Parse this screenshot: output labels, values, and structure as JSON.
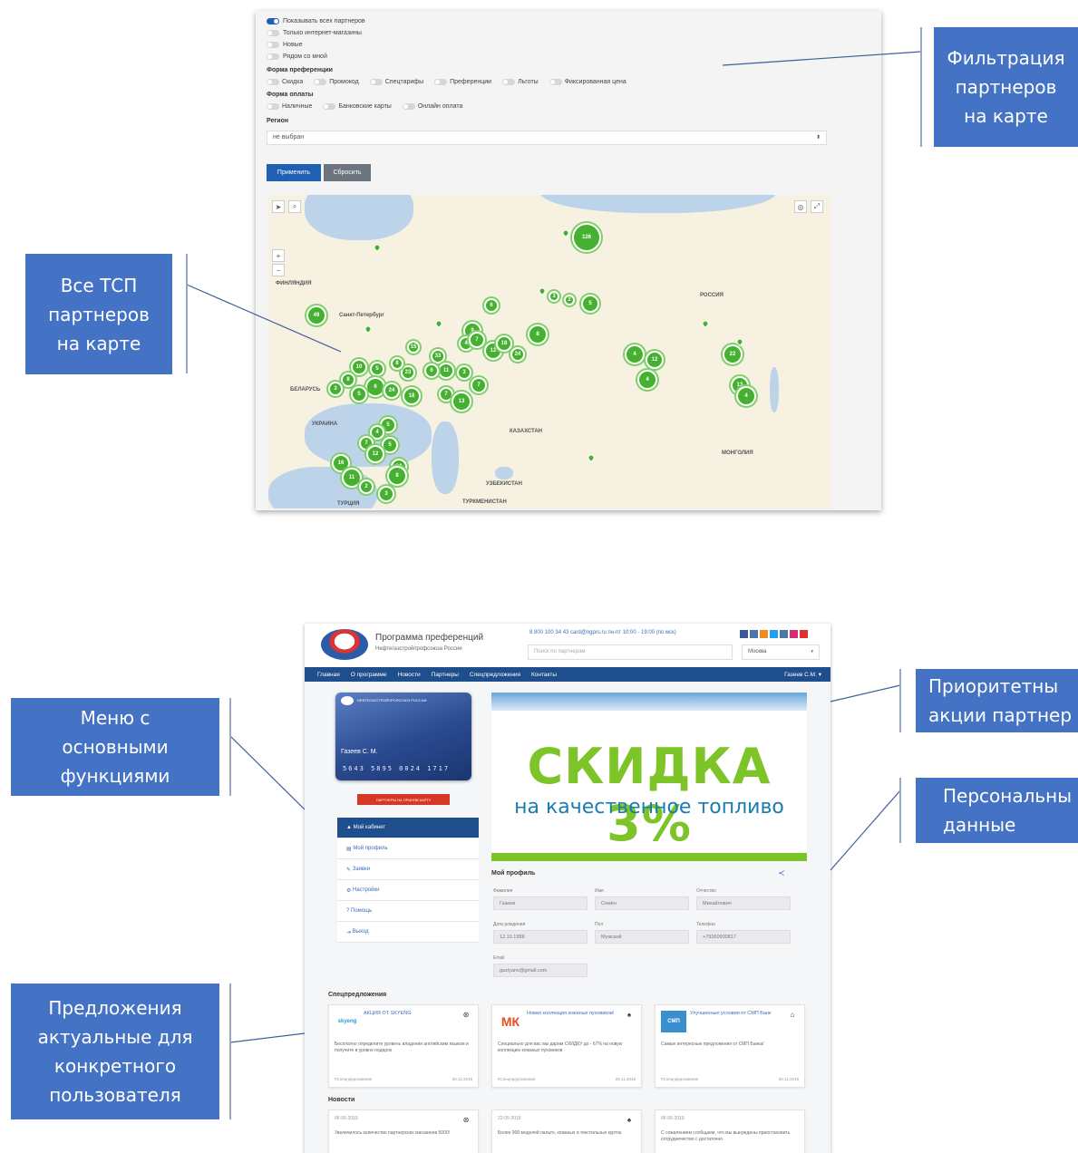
{
  "callouts": {
    "filter": "Фильтрация\nпартнеров\nна карте",
    "all_tsp": "Все ТСП\nпартнеров\nна карте",
    "menu": "Меню с\nосновными\nфункциями",
    "offers": "Предложения\nактуальные для\nконкретного\nпользователя",
    "priority": "Приоритетны\nакции партнер",
    "personal": "Персональны\nданные"
  },
  "filters": {
    "toggles": [
      {
        "label": "Показывать всех партнеров",
        "on": true
      },
      {
        "label": "Только интернет-магазины",
        "on": false
      },
      {
        "label": "Новые",
        "on": false
      },
      {
        "label": "Рядом со мной",
        "on": false
      }
    ],
    "preference_form_label": "Форма преференции",
    "preference_options": [
      "Скидка",
      "Промокод",
      "Спецтарифы",
      "Преференции",
      "Льготы",
      "Фиксированная цена"
    ],
    "payment_form_label": "Форма оплаты",
    "payment_options": [
      "Наличные",
      "Банковские карты",
      "Онлайн оплата"
    ],
    "region_label": "Регион",
    "region_value": "не выбран",
    "apply_button": "Применить",
    "reset_button": "Сбросить"
  },
  "map": {
    "labels": {
      "finland": "ФИНЛЯНДИЯ",
      "spb": "Санкт-Петербург",
      "russia": "РОССИЯ",
      "belarus": "БЕЛАРУСЬ",
      "ukraine": "УКРАИНА",
      "kazakhstan": "КАЗАХСТАН",
      "uzbekistan": "УЗБЕКИСТАН",
      "turkey": "ТУРЦИЯ",
      "turkmenistan": "ТУРКМЕНИСТАН",
      "mongolia": "МОНГОЛИЯ"
    },
    "clusters": [
      "126",
      "49",
      "6",
      "3",
      "2",
      "5",
      "9",
      "8",
      "4",
      "7",
      "12",
      "18",
      "24",
      "33",
      "15",
      "11",
      "6",
      "3",
      "23",
      "8",
      "5",
      "10",
      "8",
      "3",
      "6",
      "5",
      "24",
      "18",
      "7",
      "13",
      "7",
      "4",
      "12",
      "4",
      "22",
      "13",
      "4",
      "5",
      "4",
      "7",
      "5",
      "12",
      "23",
      "16",
      "11",
      "8",
      "2",
      "3"
    ]
  },
  "site": {
    "title": "Программа преференций",
    "subtitle": "Нефтегазстройпрофсоюза России",
    "contacts": "8 800 100 34 43  card@ngprs.ru  пн-пт 10:00 - 19:00 (по мск)",
    "search_placeholder": "Поиск по партнерам",
    "city": "Москва",
    "nav": [
      "Главная",
      "О программе",
      "Новости",
      "Партнеры",
      "Спецпредложения",
      "Контакты"
    ],
    "user": "Газеев С.М.",
    "card_header": "НЕФТЕГАЗСТРОЙПРОФСОЮЗ РОССИИ",
    "card_name": "Газеев С. М.",
    "card_number": "5643  5895  0024  1717",
    "card_button": "ПАРТНЕРЫ НА ПРИНЯВ КАРТУ",
    "menu": [
      "Мой кабинет",
      "Мой профиль",
      "Заявки",
      "Настройки",
      "Помощь",
      "Выход"
    ],
    "banner_big": "СКИДКА 3%",
    "banner_sub": "на качественное топливо",
    "profile_title": "Мой профиль",
    "profile": {
      "surname_label": "Фамилия",
      "surname": "Газеев",
      "name_label": "Имя",
      "name": "Семён",
      "patronymic_label": "Отчество",
      "patronymic": "Михайлович",
      "dob_label": "Дата рождения",
      "dob": "12.10.1988",
      "gender_label": "Пол",
      "gender": "Мужской",
      "phone_label": "Телефон",
      "phone": "+79260900817",
      "email_label": "Email",
      "email": "gaziyanv@gmail.com"
    },
    "offers_title": "Спецпредложения",
    "offers": [
      {
        "logo": "skyeng",
        "title": "АКЦИЯ ОТ SKYENG",
        "desc": "Бесплатно определите уровень владения английским языком и получите в уровне подарок",
        "cat": "#Спецпредложения",
        "date": "06.11.2018"
      },
      {
        "logo": "МК",
        "title": "Новая коллекция кожаных пуховиков!",
        "desc": "Специально для вас мы дарим СКИДКУ до - 67% на новую коллекцию кожаных пуховиков",
        "cat": "#Спецпредложения",
        "date": "06.11.2018"
      },
      {
        "logo": "СМП",
        "title": "Улучшенные условия от СМП Банк",
        "desc": "Самые интересные предложения от СМП Банка!",
        "cat": "#Спецпредложения",
        "date": "06.11.2018"
      }
    ],
    "news_title": "Новости",
    "news": [
      {
        "date": "06-06-2019",
        "desc": "Увеличилось количество партнерских магазинов 5000!"
      },
      {
        "date": "22-05-2019",
        "desc": "Более 900 моделей пальто, кожаных и текстильных курток."
      },
      {
        "date": "06-06-2019",
        "desc": "С сожалением сообщаем, что мы вынуждены приостановить сотрудничество с достаточно"
      }
    ]
  },
  "colors": {
    "accent": "#4472c4",
    "nav": "#1f4e8c",
    "cluster": "#46b030",
    "banner_green": "#7cc427"
  }
}
